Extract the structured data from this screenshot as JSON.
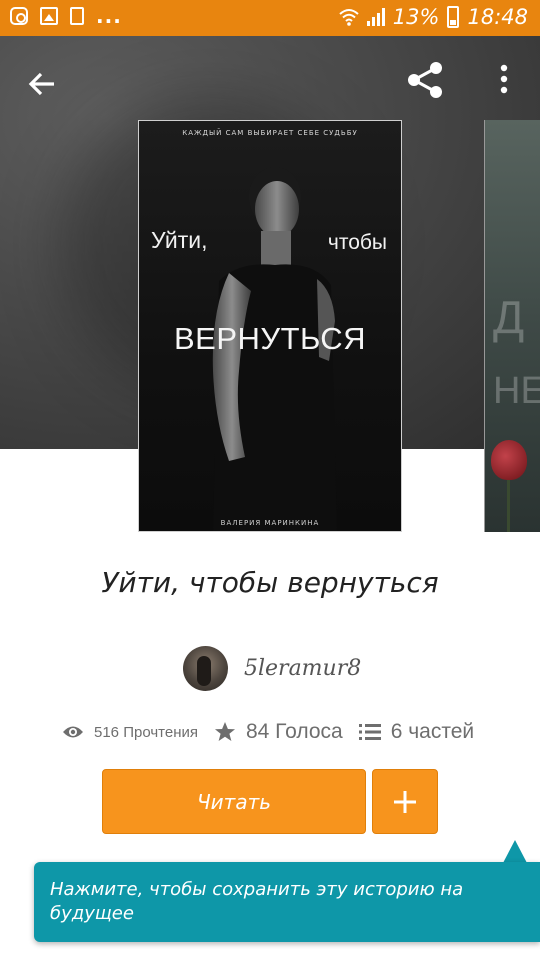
{
  "status_bar": {
    "battery": "13%",
    "time": "18:48",
    "overflow": "...",
    "icons": [
      "instagram-icon",
      "gallery-icon",
      "download-icon",
      "wifi-icon",
      "signal-icon",
      "battery-charging-icon"
    ]
  },
  "header": {
    "back_icon": "arrow-left-icon",
    "share_icon": "share-icon",
    "more_icon": "more-vert-icon"
  },
  "cover": {
    "tagline": "КАЖДЫЙ САМ ВЫБИРАЕТ СЕБЕ СУДЬБУ",
    "title_line1": "Уйти,",
    "title_line2": "чтобы",
    "title_line3": "ВЕРНУТЬСЯ",
    "author": "ВАЛЕРИЯ МАРИНКИНА"
  },
  "next_cover": {
    "letters_top": "Д",
    "letters_bottom": "НЕ"
  },
  "story": {
    "title": "Уйти, чтобы вернуться",
    "author": "5leramur8",
    "reads": "516 Прочтения",
    "votes": "84 Голоса",
    "parts": "6 частей"
  },
  "actions": {
    "read_label": "Читать",
    "add_label": "+"
  },
  "tooltip": {
    "text": "Нажмите, чтобы сохранить эту историю на будущее"
  },
  "colors": {
    "status_bar": "#e8850f",
    "accent": "#f7941d",
    "tooltip": "#0e97a8"
  }
}
